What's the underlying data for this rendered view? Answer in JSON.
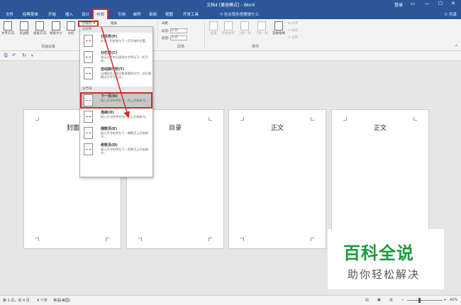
{
  "window": {
    "title": "文档4 [兼容模式] - Word",
    "login": "登录",
    "controls": [
      "▭",
      "—",
      "☐",
      "✕"
    ]
  },
  "tabs": [
    "文件",
    "经典菜单",
    "开始",
    "插入",
    "设计",
    "布局",
    "引用",
    "邮件",
    "审阅",
    "视图",
    "开发工具"
  ],
  "active_tab": "布局",
  "tell_me": "告诉我你想要做什么",
  "share": "共享",
  "ribbon": {
    "buttons": [
      "文字方向",
      "页边距",
      "纸张方向",
      "纸张大小",
      "分栏"
    ],
    "breaks_button": "分隔符",
    "page_setup_label": "页面设置",
    "indent_label": "缩进",
    "spacing_label": "间距",
    "before_label": "段前:",
    "before_value": "0 行",
    "after_label": "段后:",
    "after_value": "0 行",
    "paragraph_label": "段落",
    "arrange_buttons": [
      "位置",
      "环绕文字",
      "上移一层",
      "下移一层",
      "选择窗格"
    ],
    "arrange_small": [
      "对齐",
      "组合",
      "旋转"
    ],
    "arrange_label": "排列"
  },
  "qat": {
    "save": "🖫",
    "undo": "↶",
    "redo": "↻",
    "more": "▾"
  },
  "menu": {
    "section1": "分页符",
    "section2": "分节符",
    "items": [
      {
        "title": "分页符(P)",
        "desc": "标记一页结束与下一页开始的位置。"
      },
      {
        "title": "分栏符(C)",
        "desc": "指示分栏符后面的文字将从下一栏开始。"
      },
      {
        "title": "自动换行符(T)",
        "desc": "分隔网页上的对象周围的文字，如分隔题注文字与正文。"
      },
      {
        "title": "下一页(N)",
        "desc": "插入分节符并在下一页上开始新节。"
      },
      {
        "title": "连续(O)",
        "desc": "插入分节符并在同一页上开始新节。"
      },
      {
        "title": "偶数页(E)",
        "desc": "插入分节符并在下一偶数页上开始新节。"
      },
      {
        "title": "奇数页(D)",
        "desc": "插入分节符并在下一奇数页上开始新节。"
      }
    ]
  },
  "pages": [
    "封面",
    "目录",
    "正文",
    "正文"
  ],
  "status": {
    "page": "第 1 页，共 4 页",
    "words": "4 个字",
    "lang": "英语(美国)",
    "zoom": "42%"
  },
  "watermark": {
    "line1": "百科全说",
    "line2": "助你轻松解决"
  },
  "colors": {
    "accent": "#2b579a",
    "highlight": "#d9262c",
    "watermark": "#1a9b3a"
  }
}
